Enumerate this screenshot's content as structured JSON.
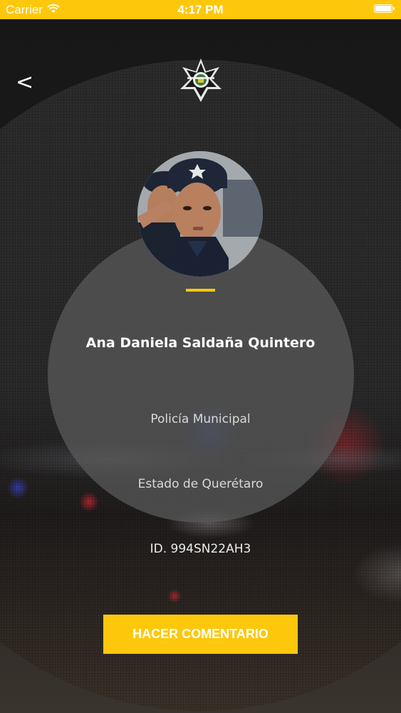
{
  "status_bar": {
    "carrier": "Carrier",
    "time": "4:17 PM"
  },
  "nav": {
    "back_label": "<"
  },
  "profile": {
    "name": "Ana Daniela Saldaña Quintero",
    "role": "Policía Municipal",
    "state": "Estado de Querétaro",
    "id_text": "ID. 994SN22AH3"
  },
  "actions": {
    "comment_button": "HACER COMENTARIO"
  },
  "icons": {
    "back": "back-chevron-icon",
    "logo": "police-star-badge-icon",
    "wifi": "wifi-icon",
    "battery": "battery-icon"
  },
  "colors": {
    "accent": "#fdc80c",
    "text": "#ffffff",
    "background": "#151515"
  }
}
